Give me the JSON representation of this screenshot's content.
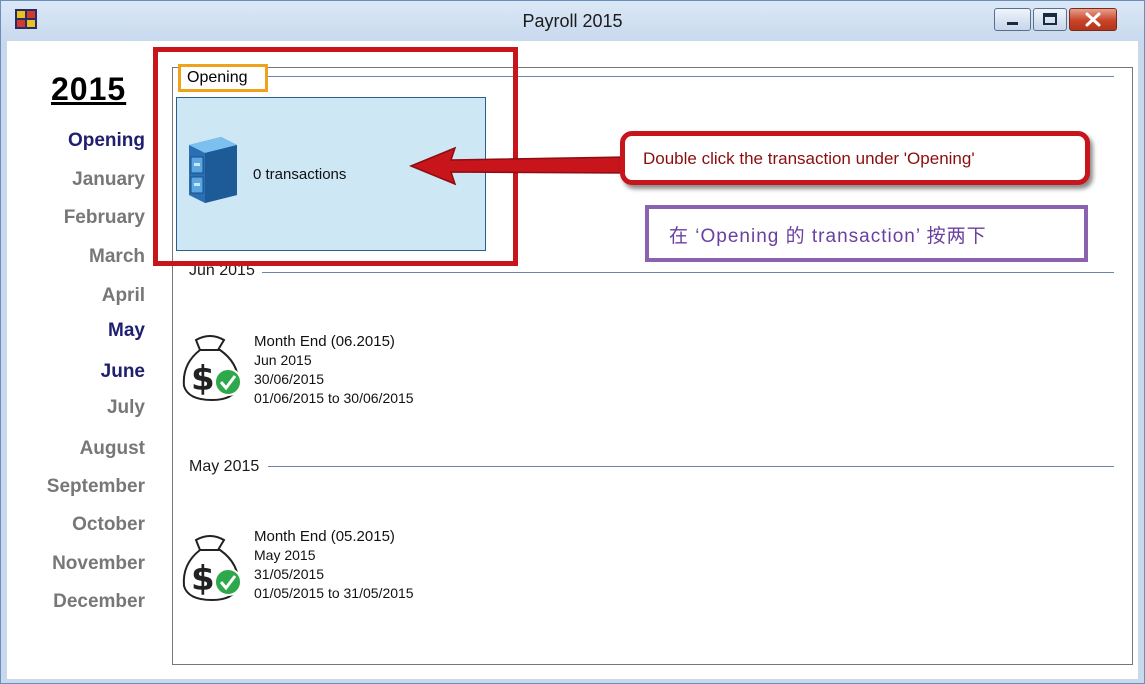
{
  "window": {
    "title": "Payroll 2015",
    "controls": [
      "minimize",
      "restore",
      "close"
    ]
  },
  "sidebar": {
    "year": "2015",
    "months": [
      {
        "label": "Opening",
        "active": true
      },
      {
        "label": "January",
        "active": false
      },
      {
        "label": "February",
        "active": false
      },
      {
        "label": "March",
        "active": false
      },
      {
        "label": "April",
        "active": false
      },
      {
        "label": "May",
        "active": true
      },
      {
        "label": "June",
        "active": true
      },
      {
        "label": "July",
        "active": false
      },
      {
        "label": "August",
        "active": false
      },
      {
        "label": "September",
        "active": false
      },
      {
        "label": "October",
        "active": false
      },
      {
        "label": "November",
        "active": false
      },
      {
        "label": "December",
        "active": false
      }
    ]
  },
  "opening": {
    "label": "Opening",
    "tile_text": "0 transactions",
    "icon": "file-cabinet-icon"
  },
  "groups": [
    {
      "header": "Jun 2015",
      "entry": {
        "title": "Month End (06.2015)",
        "period": "Jun 2015",
        "date": "30/06/2015",
        "range": "01/06/2015 to 30/06/2015",
        "icon": "money-bag-check-icon"
      }
    },
    {
      "header": "May 2015",
      "entry": {
        "title": "Month End (05.2015)",
        "period": "May 2015",
        "date": "31/05/2015",
        "range": "01/05/2015 to 31/05/2015",
        "icon": "money-bag-check-icon"
      }
    }
  ],
  "annotations": {
    "callout_en": "Double click the transaction under 'Opening'",
    "callout_cn": "在 ‘Opening 的 transaction’ 按两下",
    "colors": {
      "red": "#c8141b",
      "orange": "#f0a21c",
      "purple": "#8a62b0"
    }
  }
}
